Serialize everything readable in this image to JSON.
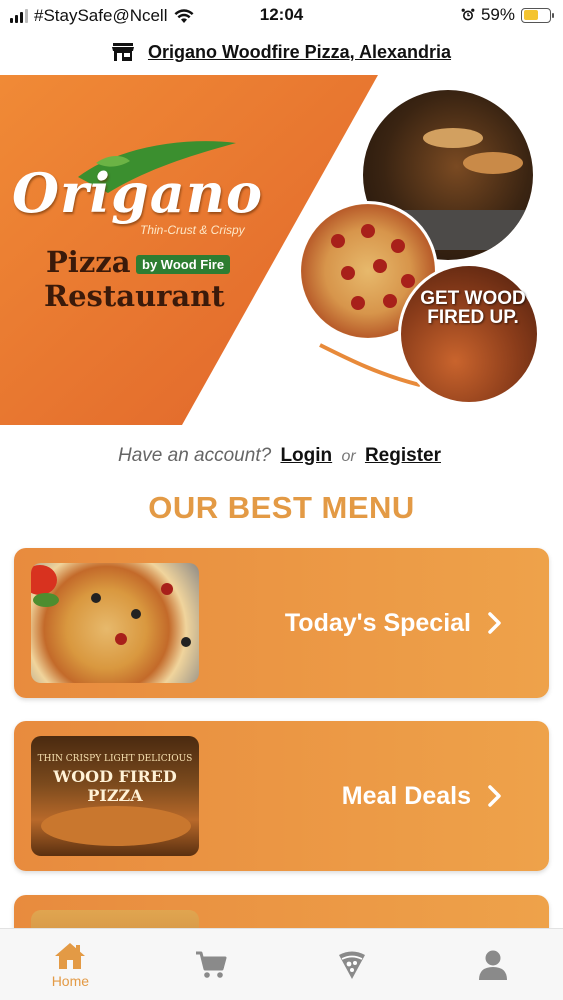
{
  "status_bar": {
    "carrier": "#StaySafe@Ncell",
    "time": "12:04",
    "battery_percent": "59%",
    "battery_level": 0.59
  },
  "header": {
    "restaurant_name": "Origano Woodfire Pizza, Alexandria",
    "store_icon": "store-icon"
  },
  "hero": {
    "logo_name": "Origano",
    "logo_tagline": "Thin-Crust & Crispy",
    "logo_line1": "Pizza",
    "logo_badge": "by Wood Fire",
    "logo_line2": "Restaurant",
    "promo_text": "GET WOOD FIRED UP."
  },
  "account": {
    "prompt": "Have an account?",
    "login_label": "Login",
    "or_label": "or",
    "register_label": "Register"
  },
  "section_title": "OUR BEST MENU",
  "menu_cards": [
    {
      "label": "Today's Special"
    },
    {
      "label": "Meal Deals",
      "image_text_1": "THIN CRISPY LIGHT DELICIOUS",
      "image_text_2": "WOOD FIRED PIZZA"
    }
  ],
  "bottom_nav": {
    "items": [
      {
        "label": "Home",
        "icon": "home-icon",
        "active": true
      },
      {
        "label": "",
        "icon": "cart-icon"
      },
      {
        "label": "",
        "icon": "pizza-slice-icon"
      },
      {
        "label": "",
        "icon": "user-icon"
      }
    ]
  },
  "colors": {
    "accent": "#e39a45",
    "hero_orange": "#e8782e",
    "card_orange": "#eea24a",
    "logo_green": "#2e7d32"
  }
}
